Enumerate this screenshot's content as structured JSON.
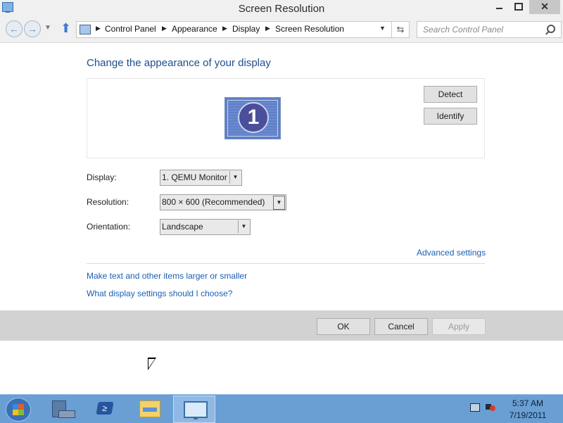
{
  "window": {
    "title": "Screen Resolution",
    "close_glyph": "✕"
  },
  "navigation": {
    "back_glyph": "←",
    "forward_glyph": "→",
    "up_glyph": "⬆",
    "refresh_glyph": "⇆",
    "breadcrumb": [
      "Control Panel",
      "Appearance",
      "Display",
      "Screen Resolution"
    ],
    "search_placeholder": "Search Control Panel"
  },
  "content": {
    "heading": "Change the appearance of your display",
    "monitor_number": "1",
    "detect_label": "Detect",
    "identify_label": "Identify",
    "display_label": "Display:",
    "display_value": "1. QEMU Monitor",
    "resolution_label": "Resolution:",
    "resolution_value": "800 × 600 (Recommended)",
    "orientation_label": "Orientation:",
    "orientation_value": "Landscape",
    "advanced_settings_link": "Advanced settings",
    "text_size_link": "Make text and other items larger or smaller",
    "help_link": "What display settings should I choose?"
  },
  "buttons": {
    "ok": "OK",
    "cancel": "Cancel",
    "apply": "Apply",
    "apply_enabled": false
  },
  "taskbar": {
    "powershell_glyph": "≥",
    "time": "5:37 AM",
    "date": "7/19/2011"
  },
  "icons": [
    "app-icon",
    "control-panel-icon",
    "search-icon",
    "windows-start-icon",
    "server-manager-icon",
    "powershell-icon",
    "file-explorer-icon",
    "screen-resolution-icon",
    "network-icon",
    "volume-icon",
    "mouse-cursor"
  ],
  "colors": {
    "heading": "#1e4e8c",
    "link": "#1a5fb4",
    "taskbar": "#6a9fd4",
    "button_bar": "#d2d2d2"
  }
}
